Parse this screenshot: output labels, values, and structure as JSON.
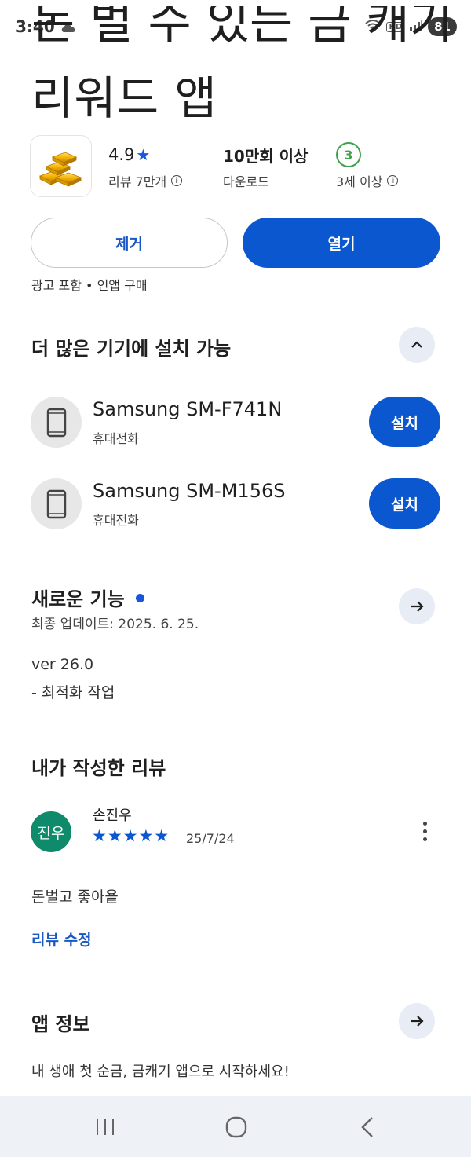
{
  "status_bar": {
    "time": "3:40",
    "battery": "81",
    "hd_label": "HD"
  },
  "app": {
    "title_partial": "돈 벌 수 있는 금 캐기 앱",
    "title": "리워드 앱",
    "rating": "4.9",
    "rating_star": "★",
    "reviews_label": "리뷰 7만개",
    "downloads": "10만회 이상",
    "downloads_label": "다운로드",
    "age_rating": "3",
    "age_label": "3세 이상",
    "info_symbol": "i"
  },
  "actions": {
    "remove_label": "제거",
    "open_label": "열기"
  },
  "ad_info": "광고 포함 • 인앱 구매",
  "devices_section": {
    "title": "더 많은 기기에 설치 가능",
    "devices": [
      {
        "name": "Samsung SM-F741N",
        "type": "휴대전화",
        "button": "설치"
      },
      {
        "name": "Samsung SM-M156S",
        "type": "휴대전화",
        "button": "설치"
      }
    ]
  },
  "whats_new": {
    "title": "새로운 기능",
    "updated": "최종 업데이트: 2025. 6. 25.",
    "version": "ver 26.0",
    "notes": "- 최적화 작업"
  },
  "my_review": {
    "title": "내가 작성한 리뷰",
    "avatar_text": "진우",
    "reviewer": "손진우",
    "stars": "★★★★★",
    "rating": 5,
    "date": "25/7/24",
    "text": "돈벌고 좋아욭",
    "edit_label": "리뷰 수정"
  },
  "app_info": {
    "title": "앱 정보",
    "description": "내 생애 첫 순금, 금캐기 앱으로 시작하세요!"
  },
  "colors": {
    "primary": "#0b57d0",
    "accent_green": "#3ea34a",
    "avatar_bg": "#0f8a6a",
    "nav_bg": "#eef1f6"
  }
}
